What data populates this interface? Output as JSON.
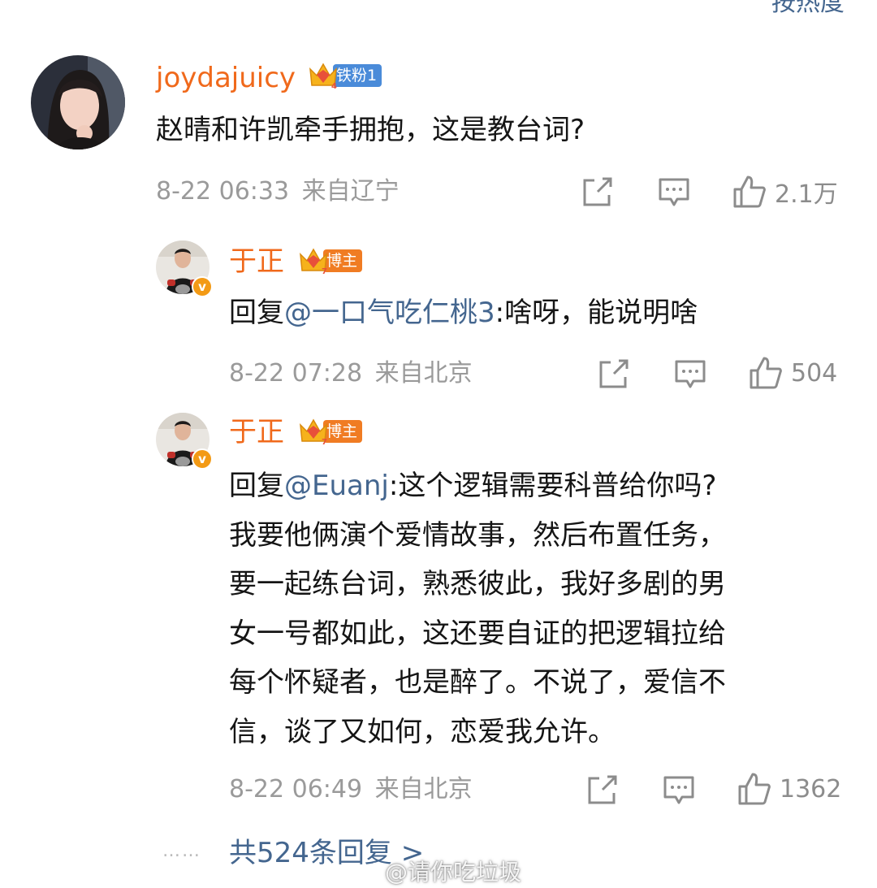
{
  "header": {
    "sort_label": "按热度"
  },
  "comments": [
    {
      "username": "joydajuicy",
      "badge": "铁粉1",
      "text": "赵晴和许凯牵手拥抱，这是教台词?",
      "time": "8-22 06:33",
      "location": "来自辽宁",
      "likes": "2.1万"
    },
    {
      "username": "于正",
      "badge": "博主",
      "reply_prefix": "回复",
      "mention": "@一口气吃仁桃3",
      "text": ":啥呀，能说明啥",
      "time": "8-22 07:28",
      "location": "来自北京",
      "likes": "504"
    },
    {
      "username": "于正",
      "badge": "博主",
      "reply_prefix": "回复",
      "mention": "@Euanj",
      "lines": [
        ":这个逻辑需要科普给你吗?",
        "我要他俩演个爱情故事，然后布置任务，",
        "要一起练台词，熟悉彼此，我好多剧的男",
        "女一号都如此，这还要自证的把逻辑拉给",
        "每个怀疑者，也是醉了。不说了，爱信不",
        "信，谈了又如何，恋爱我允许。"
      ],
      "time": "8-22 06:49",
      "location": "来自北京",
      "likes": "1362"
    }
  ],
  "footer": {
    "dots": "……",
    "more_replies": "共524条回复 >",
    "watermark": "@请你吃垃圾"
  },
  "colors": {
    "username": "#f0691b",
    "link": "#44668f",
    "meta": "#9a9a9a",
    "fan_tag": "#4a8bd9",
    "host_tag": "#f07c23"
  }
}
